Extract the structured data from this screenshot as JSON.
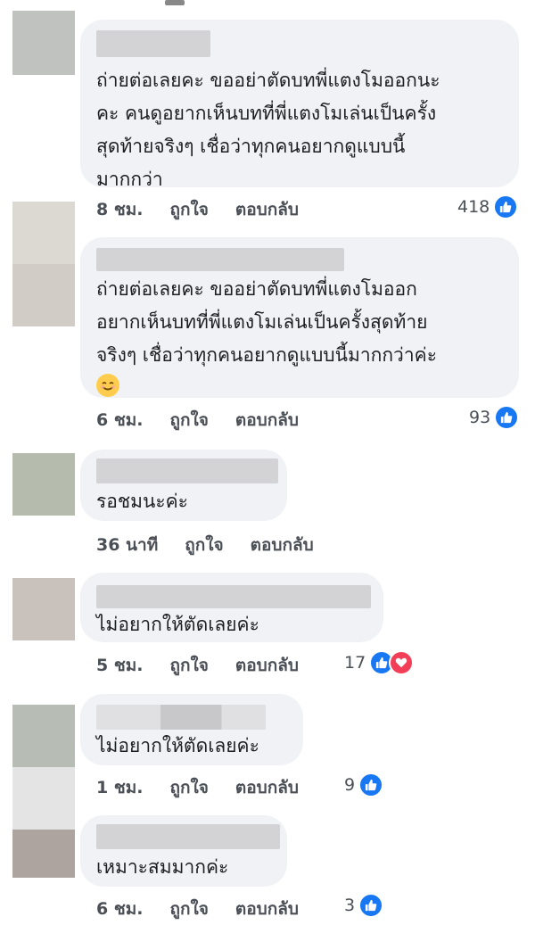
{
  "comments": [
    {
      "text": "ถ่ายต่อเลยคะ ขออย่าตัดบทพี่แตงโมออกนะ\nคะ คนดูอยากเห็นบทที่พี่แตงโมเล่นเป็นครั้ง\nสุดท้ายจริงๆ เชื่อว่าทุกคนอยากดูแบบนี้\nมากกว่า",
      "time": "8 ชม.",
      "like_label": "ถูกใจ",
      "reply_label": "ตอบกลับ",
      "reaction_count": "418",
      "avatar_color": "#bfc2bf"
    },
    {
      "text": "ถ่ายต่อเลยคะ ขออย่าตัดบทพี่แตงโมออก\nอยากเห็นบทที่พี่แตงโมเล่นเป็นครั้งสุดท้าย\nจริงๆ เชื่อว่าทุกคนอยากดูแบบนี้มากกว่าค่ะ",
      "emoji": "smiling-face-emoji",
      "time": "6 ชม.",
      "like_label": "ถูกใจ",
      "reply_label": "ตอบกลับ",
      "reaction_count": "93",
      "avatar_color": "#d8d2cc"
    },
    {
      "text": "รอชมนะค่ะ",
      "time": "36 นาที",
      "like_label": "ถูกใจ",
      "reply_label": "ตอบกลับ",
      "reaction_count": "",
      "avatar_color": "#b5bcae"
    },
    {
      "text": "ไม่อยากให้ตัดเลยค่ะ",
      "time": "5 ชม.",
      "like_label": "ถูกใจ",
      "reply_label": "ตอบกลับ",
      "reaction_count": "17",
      "avatar_color": "#c9c2bc"
    },
    {
      "text": "ไม่อยากให้ตัดเลยค่ะ",
      "time": "1 ชม.",
      "like_label": "ถูกใจ",
      "reply_label": "ตอบกลับ",
      "reaction_count": "9",
      "avatar_color": "#b7bdb5"
    },
    {
      "text": "เหมาะสมมากค่ะ",
      "time": "6 ชม.",
      "like_label": "ถูกใจ",
      "reply_label": "ตอบกลับ",
      "reaction_count": "3",
      "avatar_color": "#ada4a0"
    }
  ],
  "colors": {
    "bubble": "#f0f2f5",
    "like_blue": "#1877f2",
    "love_red": "#f33e58",
    "meta_text": "#4b4f56"
  }
}
